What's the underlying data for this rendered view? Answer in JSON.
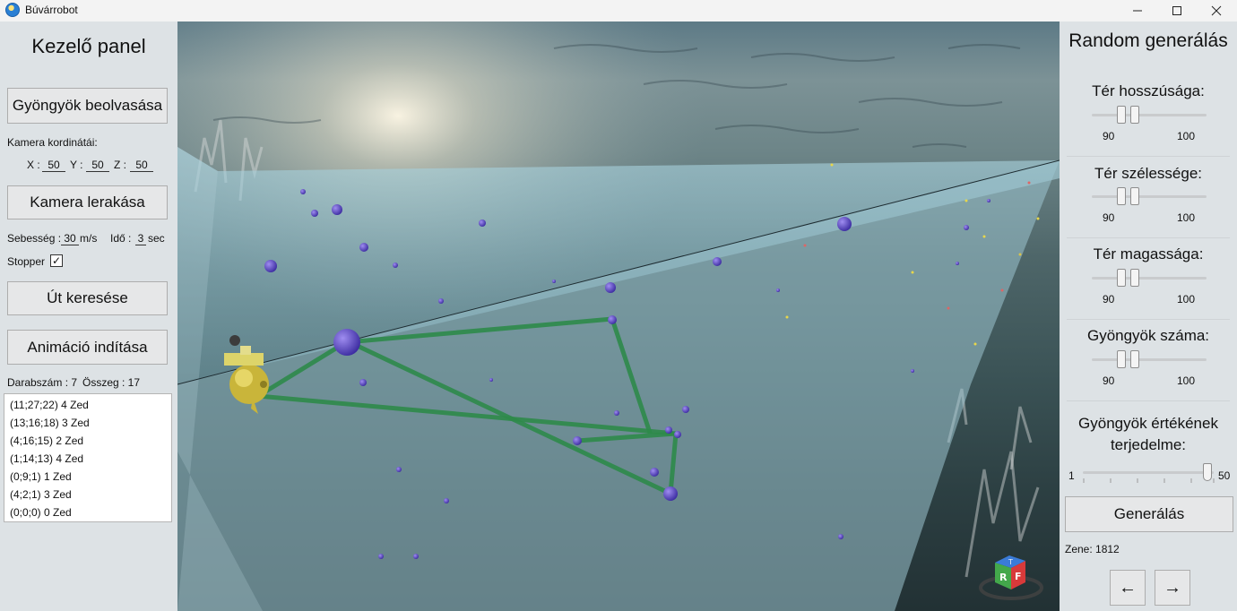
{
  "window": {
    "title": "Búvárrobot"
  },
  "left_panel": {
    "heading": "Kezelő panel",
    "load_button": "Gyöngyök beolvasása",
    "camera_coords_label": "Kamera kordinátái:",
    "x_label": "X :",
    "x_value": "50",
    "y_label": "Y :",
    "y_value": "50",
    "z_label": "Z :",
    "z_value": "50",
    "place_camera_button": "Kamera lerakása",
    "speed_label": "Sebesség :",
    "speed_value": "30",
    "speed_unit": "m/s",
    "time_label": "Idő :",
    "time_value": "3",
    "time_unit": "sec",
    "stopper_label": "Stopper",
    "stopper_checked": "✓",
    "find_path_button": "Út keresése",
    "start_animation_button": "Animáció indítása",
    "count_label": "Darabszám : 7",
    "sum_label": "Összeg : 17",
    "path_list": [
      "(11;27;22) 4 Zed",
      "(13;16;18) 3 Zed",
      "(4;16;15) 2 Zed",
      "(1;14;13) 4 Zed",
      "(0;9;1) 1 Zed",
      "(4;2;1) 3 Zed",
      "(0;0;0) 0 Zed"
    ]
  },
  "right_panel": {
    "heading": "Random generálás",
    "length_label": "Tér hosszúsága:",
    "length_min": "90",
    "length_max": "100",
    "width_label": "Tér szélessége:",
    "width_min": "90",
    "width_max": "100",
    "height_label": "Tér magassága:",
    "height_min": "90",
    "height_max": "100",
    "pearl_count_label": "Gyöngyök száma:",
    "pearl_count_min": "90",
    "pearl_count_max": "100",
    "value_range_label": "Gyöngyök értékének terjedelme:",
    "value_range_min": "1",
    "value_range_max": "50",
    "generate_button": "Generálás",
    "music_label": "Zene: 1812",
    "prev_button": "←",
    "next_button": "→"
  },
  "viewcube": {
    "top": "T",
    "left": "R",
    "right": "F"
  }
}
